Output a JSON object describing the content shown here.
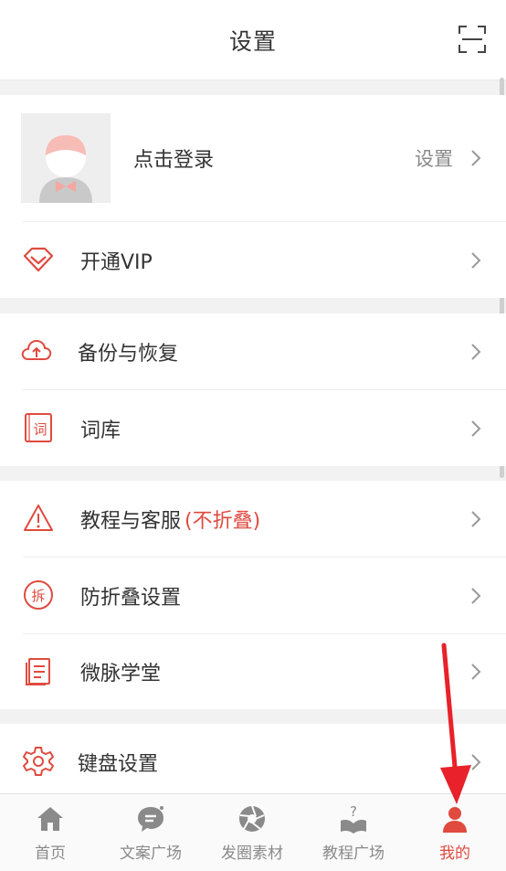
{
  "header": {
    "title": "设置",
    "scan_icon": "scan-icon"
  },
  "profile": {
    "login_text": "点击登录",
    "settings_text": "设置"
  },
  "vip": {
    "label": "开通VIP",
    "icon": "diamond-icon"
  },
  "group2": [
    {
      "label": "备份与恢复",
      "icon": "cloud-upload-icon"
    },
    {
      "label": "词库",
      "icon": "dictionary-icon"
    }
  ],
  "group3": [
    {
      "label": "教程与客服",
      "tag": "(不折叠)",
      "icon": "warning-icon"
    },
    {
      "label": "防折叠设置",
      "icon": "anti-fold-icon"
    },
    {
      "label": "微脉学堂",
      "icon": "document-icon"
    }
  ],
  "group4": [
    {
      "label": "键盘设置",
      "icon": "gear-icon"
    }
  ],
  "tabs": [
    {
      "label": "首页",
      "icon": "home-icon",
      "active": false
    },
    {
      "label": "文案广场",
      "icon": "chat-icon",
      "active": false
    },
    {
      "label": "发圈素材",
      "icon": "aperture-icon",
      "active": false
    },
    {
      "label": "教程广场",
      "icon": "book-question-icon",
      "active": false
    },
    {
      "label": "我的",
      "icon": "person-icon",
      "active": true
    }
  ],
  "colors": {
    "accent": "#e04a3f",
    "text": "#333333",
    "muted": "#888888",
    "background": "#f2f2f2"
  }
}
